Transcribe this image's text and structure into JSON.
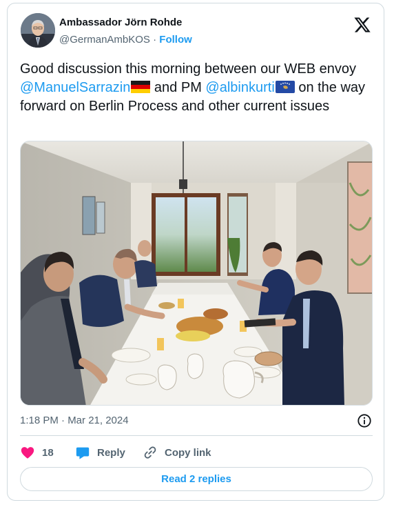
{
  "author": {
    "name": "Ambassador Jörn Rohde",
    "handle": "@GermanAmbKOS",
    "separator": "·",
    "follow_label": "Follow"
  },
  "tweet": {
    "text_1": "Good discussion this morning between our WEB envoy ",
    "mention_1": "@ManuelSarrazin",
    "text_2": " and PM ",
    "mention_2": "@albinkurti",
    "text_3": " on the way forward on Berlin Process and other current issues"
  },
  "flags": {
    "germany": "flag-germany",
    "kosovo": "flag-kosovo"
  },
  "meta": {
    "timestamp": "1:18 PM · Mar 21, 2024"
  },
  "actions": {
    "like_count": "18",
    "reply_label": "Reply",
    "copy_link_label": "Copy link"
  },
  "footer": {
    "read_replies_label": "Read 2 replies"
  },
  "colors": {
    "accent": "#1d9bf0",
    "like": "#f91880",
    "muted": "#536471"
  }
}
